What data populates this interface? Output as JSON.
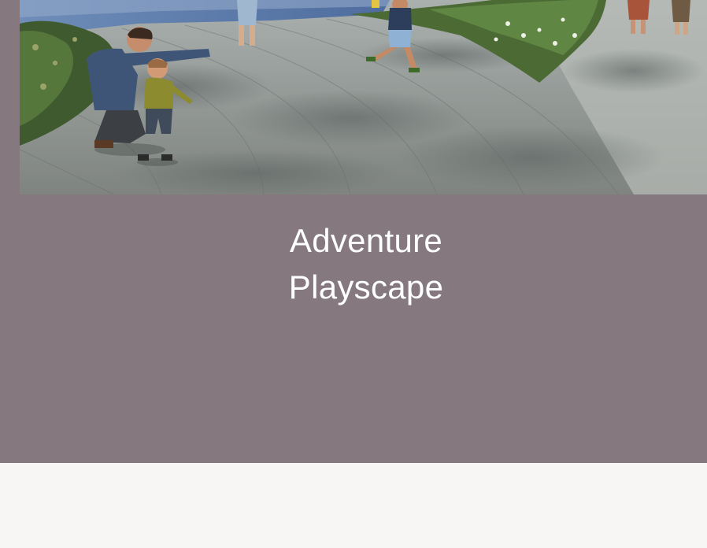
{
  "feature": {
    "image_alt": "Adults and children walking on a curved paved path beside planted garden beds",
    "title_line_1": "Adventure",
    "title_line_2": "Playscape"
  },
  "colors": {
    "panel_background": "#85797f",
    "page_background": "#f7f6f4",
    "title_text": "#ffffff"
  }
}
